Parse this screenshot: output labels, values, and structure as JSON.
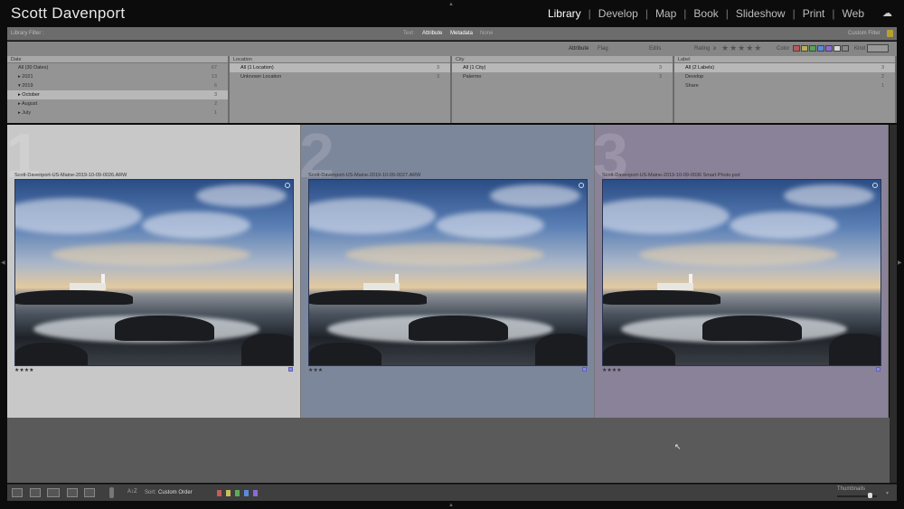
{
  "app": {
    "title": "Scott Davenport",
    "modules": [
      "Library",
      "Develop",
      "Map",
      "Book",
      "Slideshow",
      "Print",
      "Web"
    ],
    "active_module": "Library"
  },
  "filter": {
    "label": "Library Filter :",
    "tabs": [
      "Text",
      "Attribute",
      "Metadata",
      "None"
    ],
    "preset": "Custom Filter",
    "attribute": {
      "label": "Attribute",
      "flag": "Flag",
      "edits": "Edits",
      "rating": "Rating",
      "rating_op": "≥",
      "color": "Color",
      "kind": "Kind"
    },
    "color_swatches": [
      "#b85a5a",
      "#b8b05a",
      "#5aa05a",
      "#5a8ad8",
      "#8a6ad8",
      "#d8d8d8",
      "#8a8a8a"
    ],
    "columns": [
      {
        "header": "Date",
        "rows": [
          {
            "label": "All (30 Dates)",
            "count": "67",
            "sel": false
          },
          {
            "label": "▸ 2021",
            "count": "13"
          },
          {
            "label": "▾ 2019",
            "count": "6"
          },
          {
            "label": "▸ October",
            "count": "3",
            "sel": true
          },
          {
            "label": "▸ August",
            "count": "2"
          },
          {
            "label": "▸ July",
            "count": "1"
          }
        ]
      },
      {
        "header": "Location",
        "rows": [
          {
            "label": "All (1 Location)",
            "count": "3",
            "sel": true
          },
          {
            "label": "Unknown Location",
            "count": "3"
          }
        ]
      },
      {
        "header": "City",
        "rows": [
          {
            "label": "All (1 City)",
            "count": "3",
            "sel": true
          },
          {
            "label": "Palermo",
            "count": "3"
          }
        ]
      },
      {
        "header": "Label",
        "rows": [
          {
            "label": "All (2 Labels)",
            "count": "3",
            "sel": true
          },
          {
            "label": "Develop",
            "count": "2"
          },
          {
            "label": "Share",
            "count": "1"
          }
        ]
      }
    ]
  },
  "grid": [
    {
      "index": "1",
      "filename": "Scott-Davenport-US-Maine-2019-10-09-0026.ARW",
      "stars": "★★★★",
      "bg": "#c8c8c8"
    },
    {
      "index": "2",
      "filename": "Scott-Davenport-US-Maine-2019-10-09-0027.ARW",
      "stars": "★★★",
      "bg": "#7d879b"
    },
    {
      "index": "3",
      "filename": "Scott-Davenport-US-Maine-2019-10-09-0036 Smart Photo.psd",
      "stars": "★★★★",
      "bg": "#8a8299"
    }
  ],
  "toolbar": {
    "sort_label": "Sort:",
    "sort_value": "Custom Order",
    "thumbnails_label": "Thumbnails",
    "thumbnail_size": 0.85,
    "label_colors": [
      "#c85a5a",
      "#c8c05a",
      "#5ab05a",
      "#5a8ad8",
      "#8a6ad8"
    ]
  }
}
